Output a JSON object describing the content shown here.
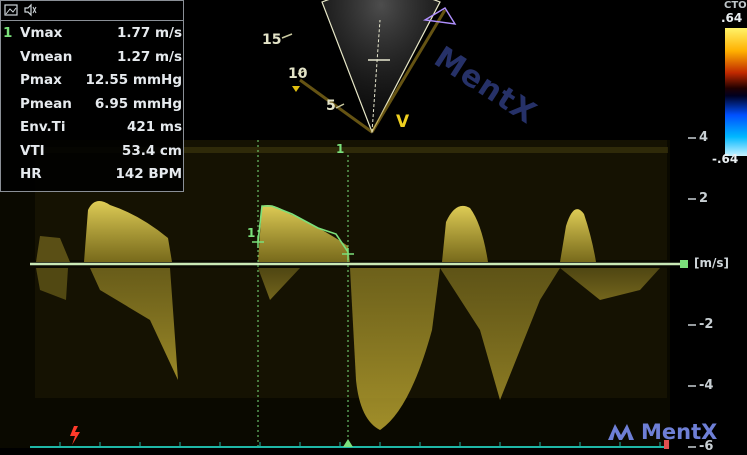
{
  "measurements": {
    "index": "1",
    "rows": [
      {
        "label": "Vmax",
        "value": "1.77 m/s"
      },
      {
        "label": "Vmean",
        "value": "1.27 m/s"
      },
      {
        "label": "Pmax",
        "value": "12.55 mmHg"
      },
      {
        "label": "Pmean",
        "value": "6.95 mmHg"
      },
      {
        "label": "Env.Ti",
        "value": "421 ms"
      },
      {
        "label": "VTI",
        "value": "53.4 cm"
      },
      {
        "label": "HR",
        "value": "142 BPM"
      }
    ]
  },
  "sector": {
    "depth_labels": [
      "15",
      "10",
      "5"
    ],
    "probe_label": "V"
  },
  "color_bar": {
    "top_label": "CTO",
    "max_label": ".64",
    "min_label": "-.64"
  },
  "velocity_scale": {
    "tick_labels": [
      "4",
      "2",
      "-2",
      "-4",
      "-6"
    ],
    "unit": "[m/s]"
  },
  "markers": {
    "cursor_label": "1",
    "trace_label": "1"
  },
  "watermark": {
    "text": "MentX",
    "corner_text": "MentX"
  },
  "colors": {
    "doppler": "#c9b23a",
    "baseline": "#b9e0a8",
    "trace": "#7be07b",
    "timeline": "#1fb7a6",
    "watermark": "#6e7fd6"
  }
}
